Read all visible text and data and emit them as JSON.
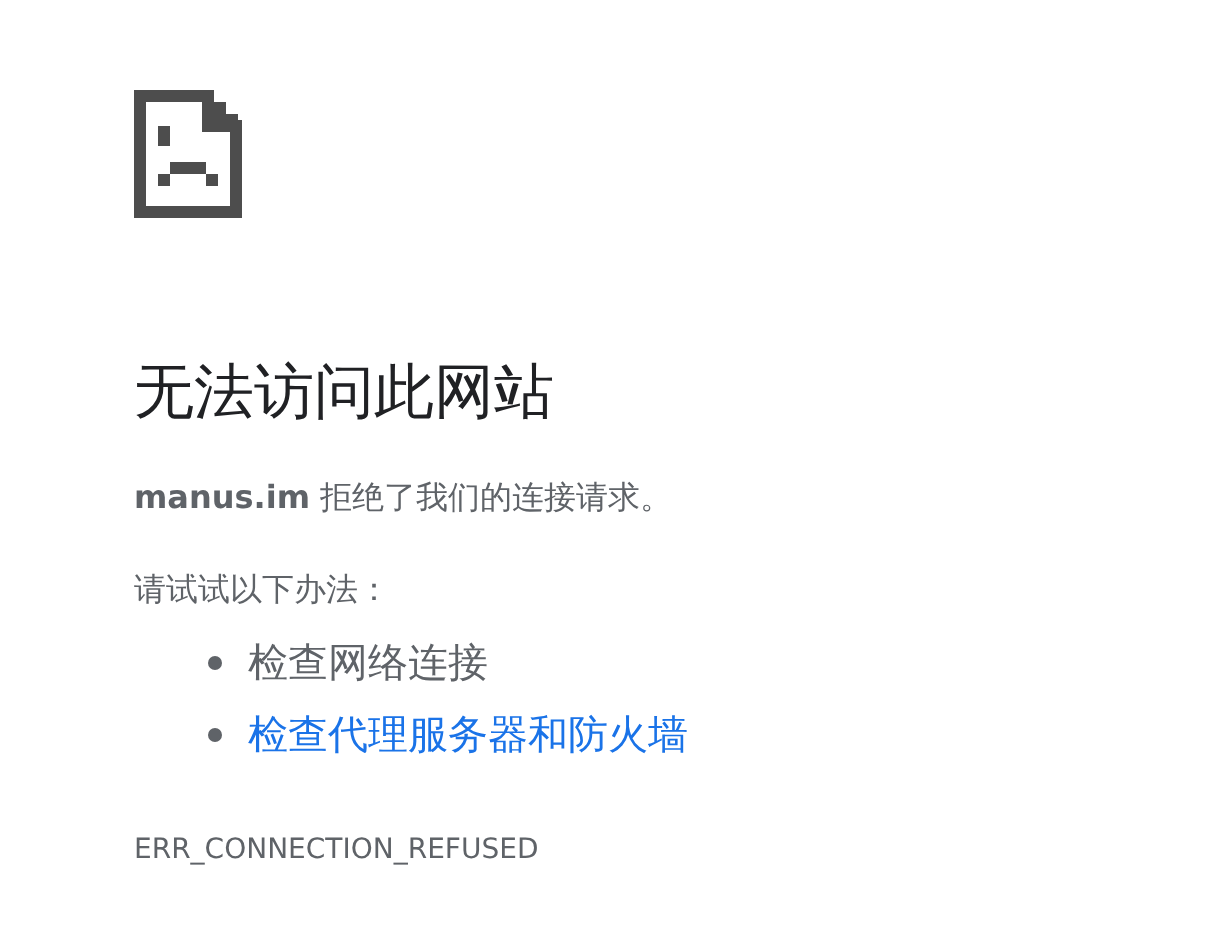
{
  "title": "无法访问此网站",
  "message": "**manus.im** 拒绝了我们的连接请求。",
  "suggestions_heading": "请试试以下办法：",
  "suggestions": [
    {
      "text": "检查网络连接",
      "kind": "text"
    },
    {
      "text": "检查代理服务器和防火墙",
      "kind": "link"
    }
  ],
  "error_code": "ERR_CONNECTION_REFUSED"
}
